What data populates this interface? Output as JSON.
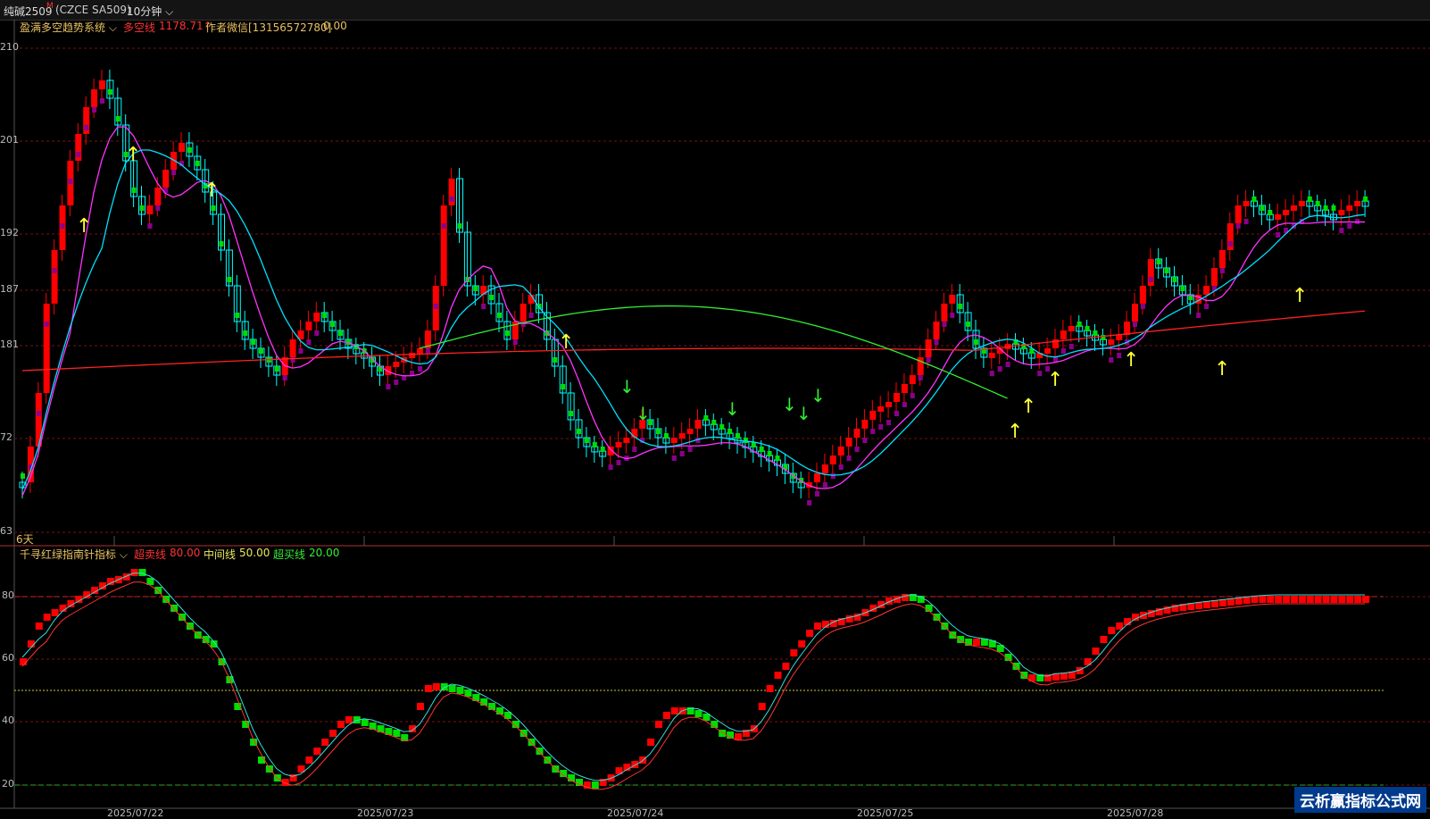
{
  "topbar": {
    "symbol": "纯碱2509",
    "superscript": "M",
    "code": "(CZCE SA509)",
    "period": "10分钟"
  },
  "main_panel": {
    "indicator_name": "盈满多空趋势系统",
    "dk_label": "多空线",
    "dk_value": "1178.71",
    "author": "作者微信[13156572780]",
    "author_value": "0.00",
    "days_label": "6天",
    "y_ticks": [
      "210",
      "201",
      "192",
      "187",
      "181",
      "72",
      "63"
    ]
  },
  "sub_panel": {
    "indicator_name": "千寻红绿指南针指标",
    "overbought_label": "超卖线",
    "overbought_value": "80.00",
    "mid_label": "中间线",
    "mid_value": "50.00",
    "oversold_label": "超买线",
    "oversold_value": "20.00",
    "y_ticks": [
      "80",
      "60",
      "40",
      "20"
    ]
  },
  "date_labels": [
    "2025/07/22",
    "2025/07/23",
    "2025/07/24",
    "2025/07/25",
    "2025/07/28"
  ],
  "watermark": "云析赢指标公式网",
  "colors": {
    "up": "#ff0000",
    "down": "#00ffff",
    "green": "#00dd00",
    "purple": "#8b008b",
    "magenta": "#ff33ff",
    "cyan_line": "#00e0ff",
    "red_line": "#ff2222",
    "green_line": "#33ee33",
    "arrow": "#ffff33"
  }
}
